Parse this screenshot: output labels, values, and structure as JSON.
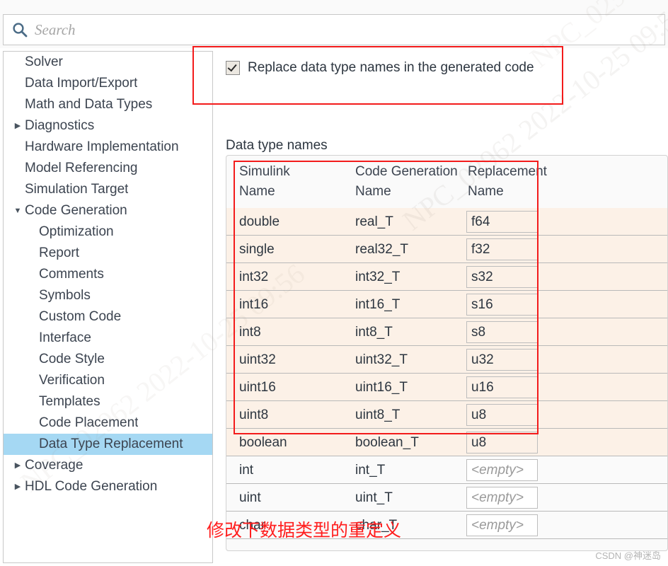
{
  "search": {
    "placeholder": "Search",
    "icon": "search-icon"
  },
  "sidebar": {
    "items": [
      {
        "label": "Solver",
        "level": 0,
        "twisty": "",
        "selected": false
      },
      {
        "label": "Data Import/Export",
        "level": 0,
        "twisty": "",
        "selected": false
      },
      {
        "label": "Math and Data Types",
        "level": 0,
        "twisty": "",
        "selected": false
      },
      {
        "label": "Diagnostics",
        "level": 0,
        "twisty": "▶",
        "selected": false
      },
      {
        "label": "Hardware Implementation",
        "level": 0,
        "twisty": "",
        "selected": false
      },
      {
        "label": "Model Referencing",
        "level": 0,
        "twisty": "",
        "selected": false
      },
      {
        "label": "Simulation Target",
        "level": 0,
        "twisty": "",
        "selected": false
      },
      {
        "label": "Code Generation",
        "level": 0,
        "twisty": "▼",
        "selected": false
      },
      {
        "label": "Optimization",
        "level": 1,
        "twisty": "",
        "selected": false
      },
      {
        "label": "Report",
        "level": 1,
        "twisty": "",
        "selected": false
      },
      {
        "label": "Comments",
        "level": 1,
        "twisty": "",
        "selected": false
      },
      {
        "label": "Symbols",
        "level": 1,
        "twisty": "",
        "selected": false
      },
      {
        "label": "Custom Code",
        "level": 1,
        "twisty": "",
        "selected": false
      },
      {
        "label": "Interface",
        "level": 1,
        "twisty": "",
        "selected": false
      },
      {
        "label": "Code Style",
        "level": 1,
        "twisty": "",
        "selected": false
      },
      {
        "label": "Verification",
        "level": 1,
        "twisty": "",
        "selected": false
      },
      {
        "label": "Templates",
        "level": 1,
        "twisty": "",
        "selected": false
      },
      {
        "label": "Code Placement",
        "level": 1,
        "twisty": "",
        "selected": false
      },
      {
        "label": "Data Type Replacement",
        "level": 1,
        "twisty": "",
        "selected": true
      },
      {
        "label": "Coverage",
        "level": 0,
        "twisty": "▶",
        "selected": false
      },
      {
        "label": "HDL Code Generation",
        "level": 0,
        "twisty": "▶",
        "selected": false
      }
    ]
  },
  "main": {
    "replace_checkbox": {
      "label": "Replace data type names in the generated code",
      "checked": true
    },
    "section_label": "Data type names",
    "table": {
      "headers": {
        "simulink_l1": "Simulink",
        "simulink_l2": "Name",
        "codegen_l1": "Code Generation",
        "codegen_l2": "Name",
        "replacement_l1": "Replacement",
        "replacement_l2": "Name"
      },
      "empty_placeholder": "<empty>",
      "rows": [
        {
          "simulink": "double",
          "codegen": "real_T",
          "replacement": "f64",
          "filled": true
        },
        {
          "simulink": "single",
          "codegen": "real32_T",
          "replacement": "f32",
          "filled": true
        },
        {
          "simulink": "int32",
          "codegen": "int32_T",
          "replacement": "s32",
          "filled": true
        },
        {
          "simulink": "int16",
          "codegen": "int16_T",
          "replacement": "s16",
          "filled": true
        },
        {
          "simulink": "int8",
          "codegen": "int8_T",
          "replacement": "s8",
          "filled": true
        },
        {
          "simulink": "uint32",
          "codegen": "uint32_T",
          "replacement": "u32",
          "filled": true
        },
        {
          "simulink": "uint16",
          "codegen": "uint16_T",
          "replacement": "u16",
          "filled": true
        },
        {
          "simulink": "uint8",
          "codegen": "uint8_T",
          "replacement": "u8",
          "filled": true
        },
        {
          "simulink": "boolean",
          "codegen": "boolean_T",
          "replacement": "u8",
          "filled": true
        },
        {
          "simulink": "int",
          "codegen": "int_T",
          "replacement": "<empty>",
          "filled": false
        },
        {
          "simulink": "uint",
          "codegen": "uint_T",
          "replacement": "<empty>",
          "filled": false
        },
        {
          "simulink": "char",
          "codegen": "char_T",
          "replacement": "<empty>",
          "filled": false
        }
      ]
    }
  },
  "annotations": {
    "chinese_note": "修改下数据类型的重定义",
    "csdn_watermark": "CSDN @神迷岛",
    "diagonal_watermark": "NPC_02962  2022-10-25  09:56",
    "highlight_color": "#f31b1b"
  }
}
